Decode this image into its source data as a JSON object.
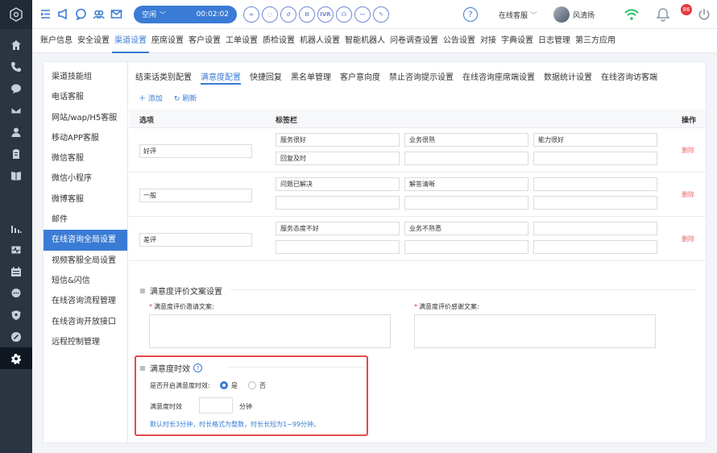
{
  "topbar": {
    "status_label": "空闲",
    "timer": "00:02:02",
    "call_buttons": [
      "∞",
      "◌",
      "↺",
      "II",
      "IVR",
      "☊",
      "⋯",
      "✎"
    ],
    "help_label": "?",
    "online_label": "在线客服",
    "user_name": "风清扬",
    "notification_count": "86"
  },
  "nav": [
    "账户信息",
    "安全设置",
    "渠道设置",
    "座席设置",
    "客户设置",
    "工单设置",
    "质检设置",
    "机器人设置",
    "智能机器人",
    "问卷调查设置",
    "公告设置",
    "对接",
    "字典设置",
    "日志管理",
    "第三方应用"
  ],
  "sidemenu": [
    "渠道技能组",
    "电话客服",
    "网站/wap/H5客服",
    "移动APP客服",
    "微信客服",
    "微信小程序",
    "微博客服",
    "邮件",
    "在线咨询全局设置",
    "视频客服全局设置",
    "短信&闪信",
    "在线咨询流程管理",
    "在线咨询开放接口",
    "远程控制管理"
  ],
  "subtabs": [
    "结束话类别配置",
    "满意度配置",
    "快捷回复",
    "黑名单管理",
    "客户意向度",
    "禁止咨询提示设置",
    "在线咨询座席端设置",
    "数据统计设置",
    "在线咨询访客端"
  ],
  "actions": {
    "add": "添加",
    "refresh": "刷新"
  },
  "table": {
    "headers": {
      "option": "选项",
      "tags": "标签栏",
      "ops": "操作"
    },
    "delete_label": "删除",
    "rows": [
      {
        "option": "好评",
        "tags": [
          "服务很好",
          "业务很熟",
          "能力很好",
          "回复及时",
          "",
          ""
        ]
      },
      {
        "option": "一般",
        "tags": [
          "问题已解决",
          "解答清晰",
          "",
          "",
          "",
          ""
        ]
      },
      {
        "option": "差评",
        "tags": [
          "服务态度不好",
          "业务不熟悉",
          "",
          "",
          "",
          ""
        ]
      }
    ]
  },
  "copy_section": {
    "title": "满意度评价文案设置",
    "invite_label": "满意度评价邀请文案:",
    "thanks_label": "满意度评价感谢文案:"
  },
  "timeout_section": {
    "title": "满意度时效",
    "enable_label": "是否开启满意度时效:",
    "yes": "是",
    "no": "否",
    "duration_label": "满意度时效",
    "unit": "分钟",
    "hint": "默认时长3分钟，时长格式为整数，时长长短为1~99分钟。"
  },
  "colors": {
    "accent": "#3a7bd5",
    "rail": "#2b3541",
    "danger": "#e24a4a"
  }
}
